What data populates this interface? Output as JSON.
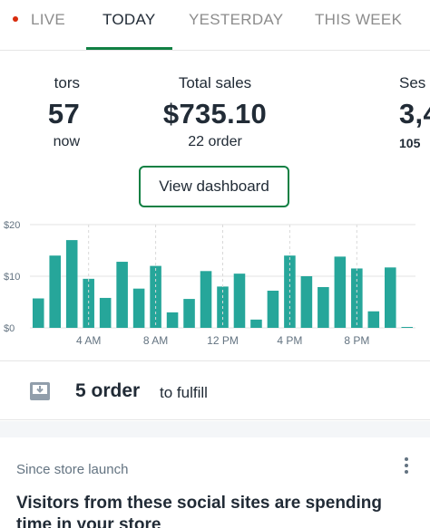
{
  "tabs": [
    {
      "label": "LIVE"
    },
    {
      "label": "TODAY"
    },
    {
      "label": "YESTERDAY"
    },
    {
      "label": "THIS WEEK"
    }
  ],
  "metrics": {
    "left": {
      "label": "tors",
      "value": "57",
      "sub": "now"
    },
    "center": {
      "label": "Total sales",
      "value": "$735.10",
      "sub": "22 order"
    },
    "right": {
      "label": "Ses",
      "value": "3,4",
      "sub": "105"
    }
  },
  "dashboard_button": {
    "label": "View dashboard"
  },
  "chart_data": {
    "type": "bar",
    "yticks": [
      "$20",
      "$10",
      "$0"
    ],
    "ylim": [
      0,
      20
    ],
    "xticks": [
      "4 AM",
      "8 AM",
      "12 PM",
      "4 PM",
      "8 PM"
    ],
    "values": [
      5.7,
      14,
      17,
      9.5,
      5.8,
      12.8,
      7.6,
      12,
      3,
      5.6,
      11,
      8,
      10.5,
      1.6,
      7.2,
      14,
      10,
      7.9,
      13.8,
      11.5,
      3.2,
      11.7,
      0
    ],
    "bar_color": "#26a69a",
    "grid": true
  },
  "fulfill": {
    "count": "5 order",
    "text": "to fulfill"
  },
  "card": {
    "since": "Since store launch",
    "title": "Visitors from these social sites are spending time in your store"
  },
  "colors": {
    "accent": "#108043",
    "live": "#d82c0d"
  }
}
